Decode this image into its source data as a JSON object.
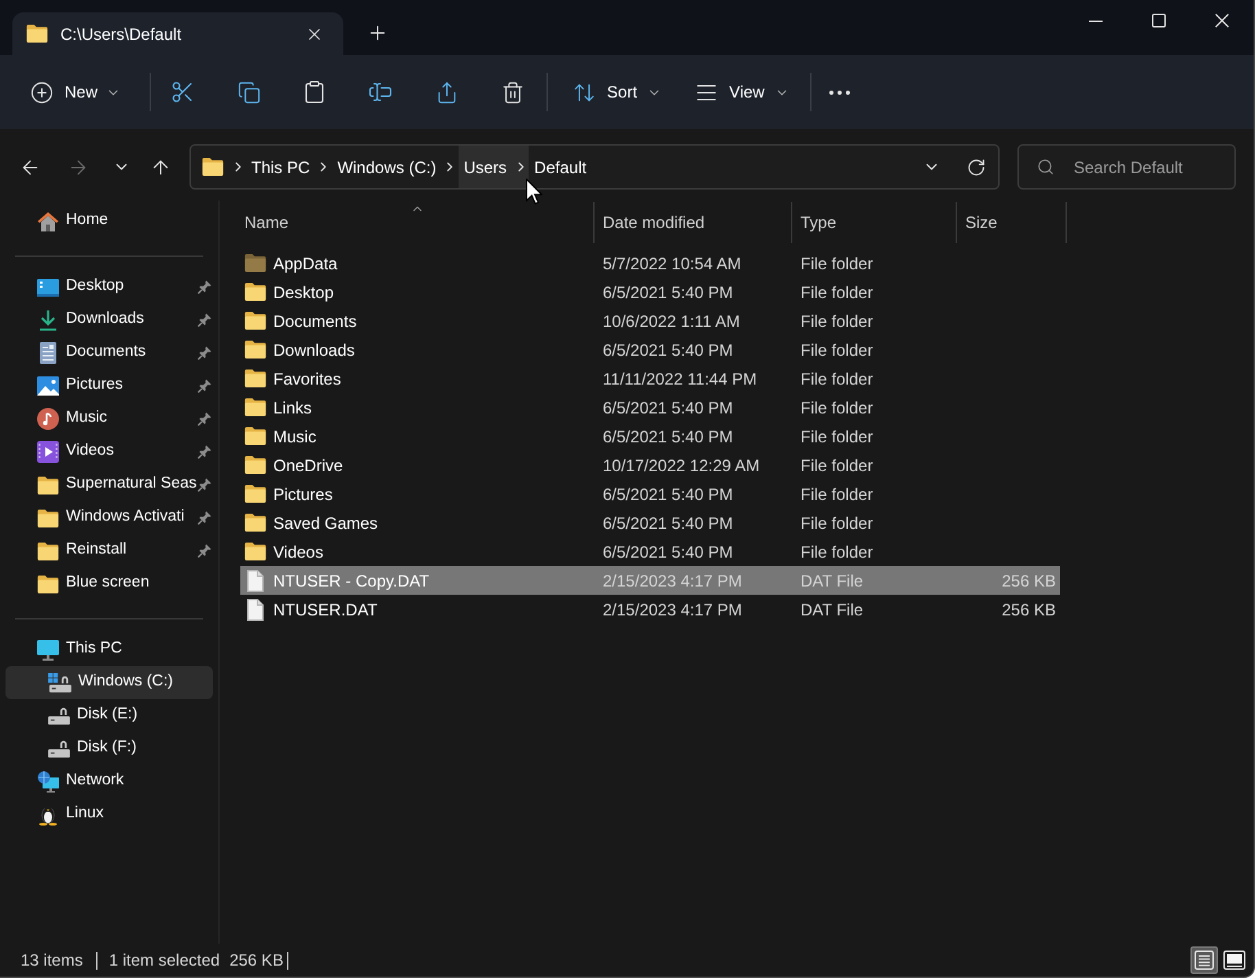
{
  "tab": {
    "title": "C:\\Users\\Default"
  },
  "toolbar": {
    "new_label": "New",
    "sort_label": "Sort",
    "view_label": "View"
  },
  "navigation": {
    "back": {
      "disabled": false
    },
    "forward": {
      "disabled": true
    }
  },
  "address_bar": {
    "crumbs": [
      {
        "label": "This PC",
        "hovered": false
      },
      {
        "label": "Windows (C:)",
        "hovered": false
      },
      {
        "label": "Users",
        "hovered": true
      },
      {
        "label": "Default",
        "hovered": false
      }
    ]
  },
  "search": {
    "placeholder": "Search Default"
  },
  "sidebar": {
    "sections": [
      {
        "items": [
          {
            "label": "Home",
            "kind": "home",
            "selected": false
          }
        ]
      },
      {
        "items": [
          {
            "label": "Desktop",
            "kind": "desktop",
            "pinned": true,
            "selected": false
          },
          {
            "label": "Downloads",
            "kind": "downloads",
            "pinned": true,
            "selected": false
          },
          {
            "label": "Documents",
            "kind": "documents",
            "pinned": true,
            "selected": false
          },
          {
            "label": "Pictures",
            "kind": "pictures",
            "pinned": true,
            "selected": false
          },
          {
            "label": "Music",
            "kind": "music",
            "pinned": true,
            "selected": false
          },
          {
            "label": "Videos",
            "kind": "videos",
            "pinned": true,
            "selected": false
          },
          {
            "label": "Supernatural Seas",
            "kind": "folder",
            "pinned": true,
            "selected": false
          },
          {
            "label": "Windows Activati",
            "kind": "folder",
            "pinned": true,
            "selected": false
          },
          {
            "label": "Reinstall",
            "kind": "folder",
            "pinned": true,
            "selected": false
          },
          {
            "label": "Blue screen",
            "kind": "folder",
            "pinned": false,
            "selected": false
          }
        ]
      },
      {
        "items": [
          {
            "label": "This PC",
            "kind": "pc",
            "selected": false,
            "children": [
              {
                "label": "Windows (C:)",
                "kind": "system_drive",
                "selected": true
              },
              {
                "label": "Disk (E:)",
                "kind": "drive",
                "selected": false
              },
              {
                "label": "Disk (F:)",
                "kind": "drive",
                "selected": false
              }
            ]
          },
          {
            "label": "Network",
            "kind": "network",
            "selected": false
          },
          {
            "label": "Linux",
            "kind": "linux",
            "selected": false
          }
        ]
      }
    ]
  },
  "file_list": {
    "columns": [
      {
        "label": "Name",
        "sorted": true
      },
      {
        "label": "Date modified",
        "sorted": false
      },
      {
        "label": "Type",
        "sorted": false
      },
      {
        "label": "Size",
        "sorted": false
      }
    ],
    "rows": [
      {
        "name": "AppData",
        "kind": "hidden_folder",
        "date_modified": "5/7/2022 10:54 AM",
        "type": "File folder",
        "selected": false
      },
      {
        "name": "Desktop",
        "kind": "folder",
        "date_modified": "6/5/2021 5:40 PM",
        "type": "File folder",
        "selected": false
      },
      {
        "name": "Documents",
        "kind": "folder",
        "date_modified": "10/6/2022 1:11 AM",
        "type": "File folder",
        "selected": false
      },
      {
        "name": "Downloads",
        "kind": "folder",
        "date_modified": "6/5/2021 5:40 PM",
        "type": "File folder",
        "selected": false
      },
      {
        "name": "Favorites",
        "kind": "folder",
        "date_modified": "11/11/2022 11:44 PM",
        "type": "File folder",
        "selected": false
      },
      {
        "name": "Links",
        "kind": "folder",
        "date_modified": "6/5/2021 5:40 PM",
        "type": "File folder",
        "selected": false
      },
      {
        "name": "Music",
        "kind": "folder",
        "date_modified": "6/5/2021 5:40 PM",
        "type": "File folder",
        "selected": false
      },
      {
        "name": "OneDrive",
        "kind": "folder",
        "date_modified": "10/17/2022 12:29 AM",
        "type": "File folder",
        "selected": false
      },
      {
        "name": "Pictures",
        "kind": "folder",
        "date_modified": "6/5/2021 5:40 PM",
        "type": "File folder",
        "selected": false
      },
      {
        "name": "Saved Games",
        "kind": "folder",
        "date_modified": "6/5/2021 5:40 PM",
        "type": "File folder",
        "selected": false
      },
      {
        "name": "Videos",
        "kind": "folder",
        "date_modified": "6/5/2021 5:40 PM",
        "type": "File folder",
        "selected": false
      },
      {
        "name": "NTUSER - Copy.DAT",
        "kind": "file",
        "date_modified": "2/15/2023 4:17 PM",
        "type": "DAT File",
        "size": "256 KB",
        "selected": true
      },
      {
        "name": "NTUSER.DAT",
        "kind": "file",
        "date_modified": "2/15/2023 4:17 PM",
        "type": "DAT File",
        "size": "256 KB",
        "selected": false
      }
    ]
  },
  "status_bar": {
    "item_count": "13 items",
    "selection": "1 item selected",
    "selection_size": "256 KB",
    "views": [
      {
        "kind": "details",
        "selected": true
      },
      {
        "kind": "tiles",
        "selected": false
      }
    ]
  }
}
